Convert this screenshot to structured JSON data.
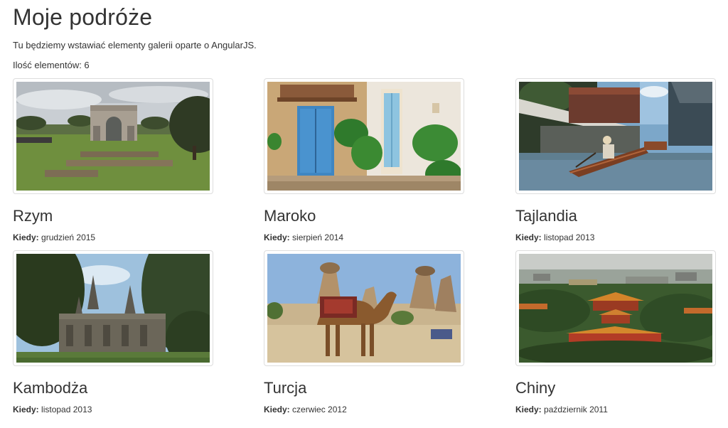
{
  "page": {
    "title": "Moje podróże",
    "intro": "Tu będziemy wstawiać elementy galerii oparte o AngularJS.",
    "count_label": "Ilość elementów: 6"
  },
  "when_label": "Kiedy:",
  "gallery": [
    {
      "name": "Rzym",
      "date": "grudzień 2015",
      "image": "rome-arch-photo"
    },
    {
      "name": "Maroko",
      "date": "sierpień 2014",
      "image": "morocco-doors-photo"
    },
    {
      "name": "Tajlandia",
      "date": "listopad 2013",
      "image": "thailand-boat-photo"
    },
    {
      "name": "Kambodża",
      "date": "listopad 2013",
      "image": "angkor-temple-photo"
    },
    {
      "name": "Turcja",
      "date": "czerwiec 2012",
      "image": "camel-photo"
    },
    {
      "name": "Chiny",
      "date": "październik 2011",
      "image": "forbidden-city-photo"
    }
  ]
}
